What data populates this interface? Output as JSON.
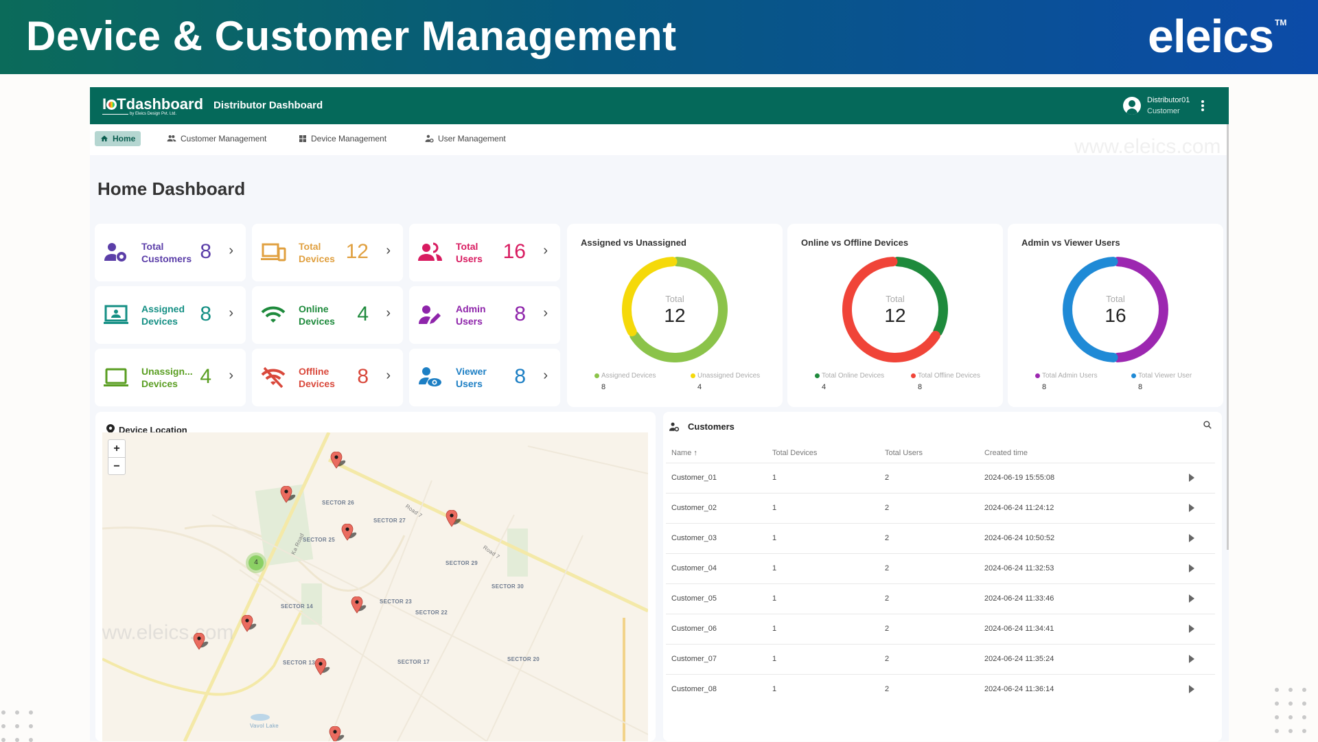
{
  "banner": {
    "title": "Device & Customer Management",
    "brand": "eleics",
    "trademark": "TM"
  },
  "appbar": {
    "logo_text": "IOTdashboard",
    "logo_prefix": "I",
    "logo_suffix": "Tdashboard",
    "logo_tagline": "by Eleics Design Pvt. Ltd.",
    "title": "Distributor Dashboard",
    "user_name": "Distributor01",
    "user_role": "Customer",
    "menu_glyph": "⋮"
  },
  "nav": {
    "tabs": [
      {
        "label": "Home",
        "icon": "home-icon",
        "active": true
      },
      {
        "label": "Customer Management",
        "icon": "people-icon",
        "active": false
      },
      {
        "label": "Device Management",
        "icon": "dashboard-grid-icon",
        "active": false
      },
      {
        "label": "User Management",
        "icon": "user-settings-icon",
        "active": false
      }
    ]
  },
  "watermark": "www.eleics.com",
  "page_title": "Home Dashboard",
  "stats": [
    {
      "line1": "Total",
      "line2": "Customers",
      "value": "8",
      "color": "#5b3ea8",
      "icon": "customer-settings-icon"
    },
    {
      "line1": "Total",
      "line2": "Devices",
      "value": "12",
      "color": "#e0a040",
      "icon": "devices-icon"
    },
    {
      "line1": "Total",
      "line2": "Users",
      "value": "16",
      "color": "#d81b60",
      "icon": "users-icon"
    },
    {
      "line1": "Assigned",
      "line2": "Devices",
      "value": "8",
      "color": "#148f84",
      "icon": "assigned-device-icon"
    },
    {
      "line1": "Online",
      "line2": "Devices",
      "value": "4",
      "color": "#1e8a3c",
      "icon": "wifi-icon"
    },
    {
      "line1": "Admin",
      "line2": "Users",
      "value": "8",
      "color": "#8e24aa",
      "icon": "admin-edit-icon"
    },
    {
      "line1": "Unassign...",
      "line2": "Devices",
      "value": "4",
      "color": "#5a9e22",
      "icon": "laptop-icon"
    },
    {
      "line1": "Offline",
      "line2": "Devices",
      "value": "8",
      "color": "#d9483b",
      "icon": "wifi-off-icon"
    },
    {
      "line1": "Viewer",
      "line2": "Users",
      "value": "8",
      "color": "#1d7fc4",
      "icon": "viewer-eye-icon"
    }
  ],
  "stat_chevron": "›",
  "chart_data": [
    {
      "type": "pie",
      "title": "Assigned vs Unassigned",
      "center_label": "Total",
      "center_value": "12",
      "categories": [
        "Assigned Devices",
        "Unassigned Devices"
      ],
      "values": [
        8,
        4
      ],
      "colors": [
        "#8bc34a",
        "#f5d90a"
      ]
    },
    {
      "type": "pie",
      "title": "Online vs Offline Devices",
      "center_label": "Total",
      "center_value": "12",
      "categories": [
        "Total Online Devices",
        "Total Offline Devices"
      ],
      "values": [
        4,
        8
      ],
      "colors": [
        "#1e8a3c",
        "#f04438"
      ]
    },
    {
      "type": "pie",
      "title": "Admin vs Viewer Users",
      "center_label": "Total",
      "center_value": "16",
      "categories": [
        "Total Admin Users",
        "Total Viewer User"
      ],
      "values": [
        8,
        8
      ],
      "colors": [
        "#9c27b0",
        "#1f8ad6"
      ]
    }
  ],
  "map": {
    "title": "Device Location",
    "zoom_in": "+",
    "zoom_out": "−",
    "cluster_count": "4",
    "sectors": [
      "SECTOR 26",
      "SECTOR 27",
      "SECTOR 25",
      "SECTOR 29",
      "SECTOR 30",
      "SECTOR 14",
      "SECTOR 23",
      "SECTOR 22",
      "SECTOR 13",
      "SECTOR 17",
      "SECTOR 20"
    ],
    "roads": [
      "Road 7",
      "Road 7",
      "Ka Road"
    ],
    "lake": "Vavol Lake",
    "marker_count": 9
  },
  "customers": {
    "title": "Customers",
    "columns": [
      "Name",
      "Total Devices",
      "Total Users",
      "Created time"
    ],
    "sort_indicator": "↑",
    "rows": [
      {
        "name": "Customer_01",
        "devices": "1",
        "users": "2",
        "created": "2024-06-19 15:55:08"
      },
      {
        "name": "Customer_02",
        "devices": "1",
        "users": "2",
        "created": "2024-06-24 11:24:12"
      },
      {
        "name": "Customer_03",
        "devices": "1",
        "users": "2",
        "created": "2024-06-24 10:50:52"
      },
      {
        "name": "Customer_04",
        "devices": "1",
        "users": "2",
        "created": "2024-06-24 11:32:53"
      },
      {
        "name": "Customer_05",
        "devices": "1",
        "users": "2",
        "created": "2024-06-24 11:33:46"
      },
      {
        "name": "Customer_06",
        "devices": "1",
        "users": "2",
        "created": "2024-06-24 11:34:41"
      },
      {
        "name": "Customer_07",
        "devices": "1",
        "users": "2",
        "created": "2024-06-24 11:35:24"
      },
      {
        "name": "Customer_08",
        "devices": "1",
        "users": "2",
        "created": "2024-06-24 11:36:14"
      }
    ]
  }
}
